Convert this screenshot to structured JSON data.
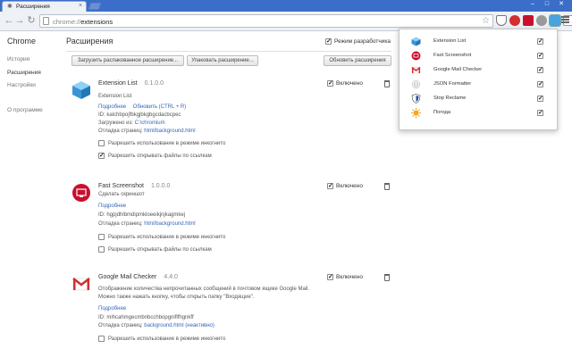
{
  "window": {
    "tab_title": "Расширения",
    "tab_icon": "puzzle-icon",
    "controls": [
      "–",
      "□",
      "✕"
    ]
  },
  "toolbar": {
    "url_scheme": "chrome://",
    "url_path": "extensions"
  },
  "sidebar": {
    "brand": "Chrome",
    "items": [
      {
        "label": "История"
      },
      {
        "label": "Расширения"
      },
      {
        "label": "Настройки"
      },
      {
        "label": "О программе"
      }
    ]
  },
  "main": {
    "title": "Расширения",
    "dev_mode_label": "Режим разработчика",
    "dev_mode_checked": true,
    "buttons": {
      "load_unpacked": "Загрузить распакованное расширение...",
      "pack": "Упаковать расширение...",
      "update": "Обновить расширения"
    }
  },
  "extensions": [
    {
      "name": "Extension List",
      "version": "0.1.0.0",
      "description": "Extension List",
      "details_link": "Подробнее",
      "reload_link": "Обновить (CTRL + R)",
      "id_label": "ID:",
      "id": "kalchbpojfbkgjbkgbgcdacbcpec",
      "loaded_label": "Загружено из:",
      "loaded_path": "C:\\chromium",
      "inspect_label": "Отладка страниц:",
      "inspect_link": "html/background.html",
      "incognito_label": "Разрешить использование в режиме инкогнито",
      "incognito_checked": false,
      "file_urls_label": "Разрешить открывать файлы по ссылкам",
      "file_urls_checked": true,
      "enabled_label": "Включено",
      "enabled": true
    },
    {
      "name": "Fast Screenshot",
      "version": "1.0.0.0",
      "description": "Сделать скриншот",
      "details_link": "Подробнее",
      "id_label": "ID:",
      "id": "hgpjdhlbmdipmkloeeikjnjkagmkej",
      "inspect_label": "Отладка страниц:",
      "inspect_link": "html/background.html",
      "incognito_label": "Разрешить использование в режиме инкогнито",
      "incognito_checked": false,
      "file_urls_label": "Разрешить открывать файлы по ссылкам",
      "file_urls_checked": false,
      "enabled_label": "Включено",
      "enabled": true
    },
    {
      "name": "Google Mail Checker",
      "version": "4.4.0",
      "description": "Отображение количества непрочитанных сообщений в почтовом ящике Google Mail. Можно также нажать кнопку, чтобы открыть папку \"Входящие\".",
      "details_link": "Подробнее",
      "id_label": "ID:",
      "id": "mihcahmgecmbnbcchbopgniflfhgnkff",
      "inspect_label": "Отладка страниц:",
      "inspect_link": "background.html (неактивно)",
      "incognito_label": "Разрешить использование в режиме инкогнито",
      "incognito_checked": false,
      "enabled_label": "Включено",
      "enabled": true
    }
  ],
  "popup": {
    "items": [
      {
        "label": "Extension List",
        "icon": "cube-icon",
        "checked": true
      },
      {
        "label": "Fast Screenshot",
        "icon": "screenshot-icon",
        "checked": true
      },
      {
        "label": "Google Mail Checker",
        "icon": "gmail-icon",
        "checked": true
      },
      {
        "label": "JSON Formatter",
        "icon": "json-icon",
        "checked": true
      },
      {
        "label": "Stop Reclame",
        "icon": "shield-icon",
        "checked": true
      },
      {
        "label": "Погода",
        "icon": "sun-icon",
        "checked": true
      }
    ]
  },
  "colors": {
    "titlebar": "#3b6ec8",
    "link": "#3366bb",
    "screenshot_red": "#c8102e",
    "gmail_red": "#d32f2f",
    "cube_blue": "#4aa3df",
    "sun_orange": "#f5a623"
  }
}
